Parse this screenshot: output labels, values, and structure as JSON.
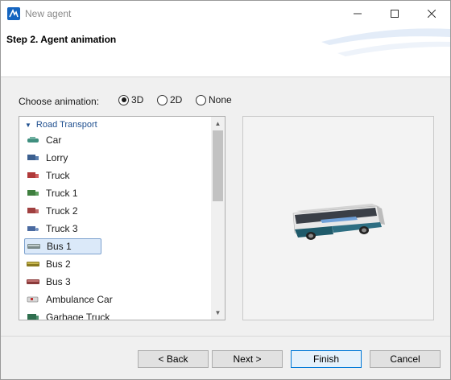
{
  "window": {
    "title": "New agent"
  },
  "header": {
    "step_title": "Step 2. Agent animation"
  },
  "animation": {
    "label": "Choose animation:",
    "options": [
      {
        "label": "3D",
        "checked": true
      },
      {
        "label": "2D",
        "checked": false
      },
      {
        "label": "None",
        "checked": false
      }
    ]
  },
  "list": {
    "group": "Road Transport",
    "items": [
      {
        "label": "Car",
        "icon": "car-icon",
        "color": "#3f8f7f"
      },
      {
        "label": "Lorry",
        "icon": "lorry-icon",
        "color": "#3c5f8f"
      },
      {
        "label": "Truck",
        "icon": "truck-icon",
        "color": "#b03a3a"
      },
      {
        "label": "Truck 1",
        "icon": "truck-1-icon",
        "color": "#3f7f3f"
      },
      {
        "label": "Truck 2",
        "icon": "truck-2-icon",
        "color": "#a04040"
      },
      {
        "label": "Truck 3",
        "icon": "truck-3-icon",
        "color": "#4a6aa0"
      },
      {
        "label": "Bus 1",
        "icon": "bus-1-icon",
        "color": "#7a8a8a",
        "selected": true
      },
      {
        "label": "Bus 2",
        "icon": "bus-2-icon",
        "color": "#8a7a20"
      },
      {
        "label": "Bus 3",
        "icon": "bus-3-icon",
        "color": "#8a3a3a"
      },
      {
        "label": "Ambulance Car",
        "icon": "ambulance-icon",
        "color": "#909090"
      },
      {
        "label": "Garbage Truck",
        "icon": "garbage-truck-icon",
        "color": "#2f6f4f"
      }
    ]
  },
  "preview": {
    "model": "bus-3d-model"
  },
  "buttons": {
    "back": "< Back",
    "next": "Next >",
    "finish": "Finish",
    "cancel": "Cancel"
  }
}
